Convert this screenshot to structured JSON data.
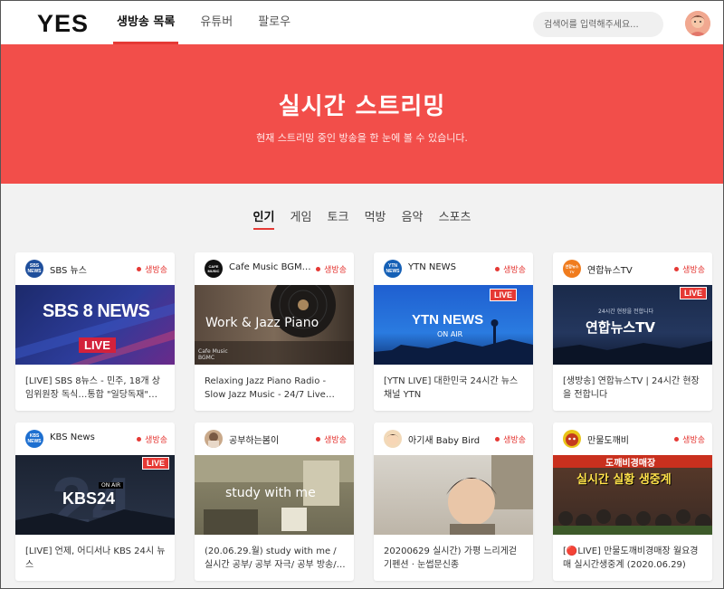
{
  "header": {
    "logo": "YES",
    "nav": [
      {
        "label": "생방송 목록",
        "active": true
      },
      {
        "label": "유튜버",
        "active": false
      },
      {
        "label": "팔로우",
        "active": false
      }
    ],
    "search_placeholder": "검색어를 입력해주세요...",
    "accent_color": "#e53935"
  },
  "hero": {
    "title": "실시간 스트리밍",
    "subtitle": "현재 스트리밍 중인 방송을 한 눈에 볼 수 있습니다.",
    "background": "#f24e4a"
  },
  "categories": [
    {
      "label": "인기",
      "active": true
    },
    {
      "label": "게임",
      "active": false
    },
    {
      "label": "토크",
      "active": false
    },
    {
      "label": "먹방",
      "active": false
    },
    {
      "label": "음악",
      "active": false
    },
    {
      "label": "스포츠",
      "active": false
    }
  ],
  "live_label": "생방송",
  "cards": [
    {
      "channel": "SBS 뉴스",
      "logo_text": "SBS NEWS",
      "thumb_text": "SBS 8 NEWS",
      "thumb_badge": "LIVE",
      "title": "[LIVE] SBS 8뉴스 - 민주, 18개 상임위원장 독식…통합 \"일당독재\" 外…"
    },
    {
      "channel": "Cafe Music BGM…",
      "logo_text": "CAFE MUSIC",
      "thumb_text": "Work & Jazz Piano",
      "thumb_small": "Cafe Music BGMC",
      "title": "Relaxing Jazz Piano Radio - Slow Jazz Music - 24/7 Live Stream -…"
    },
    {
      "channel": "YTN NEWS",
      "logo_text": "YTN NEWS",
      "thumb_text": "YTN NEWS",
      "thumb_small": "ON AIR",
      "thumb_badge": "LIVE",
      "title": "[YTN LIVE] 대한민국 24시간 뉴스채널 YTN"
    },
    {
      "channel": "연합뉴스TV",
      "logo_text": "연합뉴스TV",
      "thumb_text": "연합뉴스TV",
      "thumb_small": "24시간 현장을 전합니다",
      "thumb_badge": "LIVE",
      "title": "[생방송] 연합뉴스TV | 24시간 현장을 전합니다"
    },
    {
      "channel": "KBS News",
      "logo_text": "KBS NEWS",
      "thumb_text": "KBS24",
      "thumb_small": "ON AIR",
      "thumb_badge": "LIVE",
      "title": "[LIVE] 언제, 어디서나 KBS 24시 뉴스"
    },
    {
      "channel": "공부하는봄이",
      "logo_text": "",
      "thumb_text": "study with me",
      "title": "(20.06.29.월) study with me / 실시간 공부/ 공부 자극/ 공부 방송/…"
    },
    {
      "channel": "아기새 Baby Bird",
      "logo_text": "",
      "title": "20200629 실시간) 가평 느리게걷기펜션 · 눈썹문신종"
    },
    {
      "channel": "만물도깨비",
      "logo_text": "",
      "thumb_text": "실시간 실황 생중계",
      "thumb_small": "도깨비경매장",
      "title": "[🔴LIVE] 만물도깨비경매장 월요경매 실시간생중계 (2020.06.29)"
    }
  ]
}
